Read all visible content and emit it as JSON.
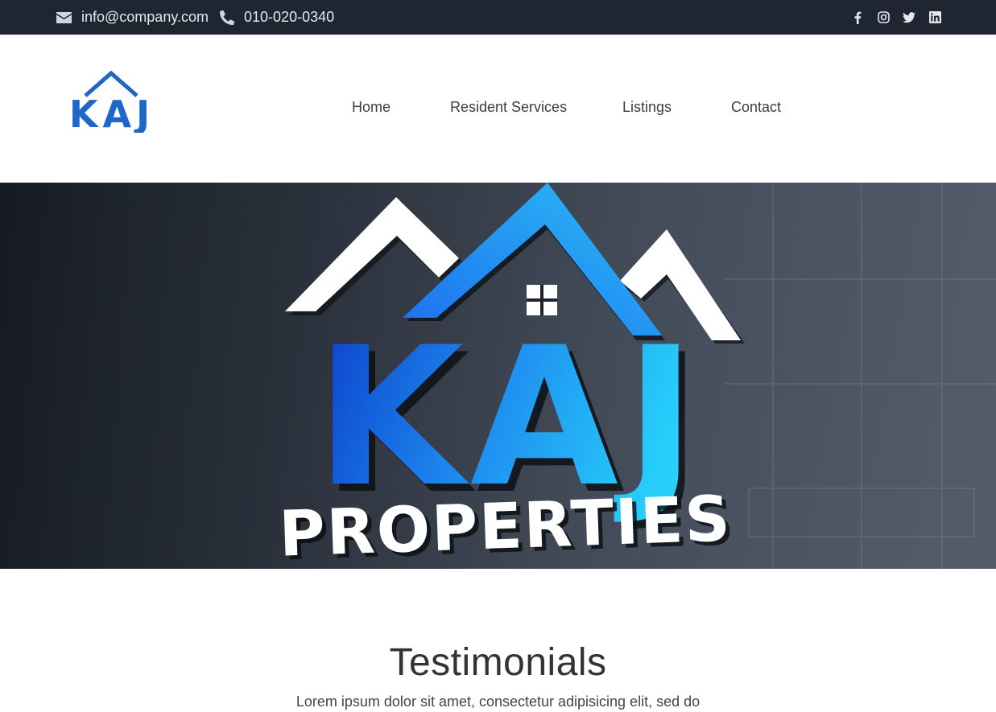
{
  "topbar": {
    "email": "info@company.com",
    "phone": "010-020-0340",
    "social_icons": [
      "facebook-icon",
      "instagram-icon",
      "twitter-icon",
      "linkedin-icon"
    ]
  },
  "header": {
    "logo_text": "KAJ",
    "nav": [
      "Home",
      "Resident Services",
      "Listings",
      "Contact"
    ]
  },
  "hero": {
    "logo_letters": "KAJ",
    "logo_word": "PROPERTIES"
  },
  "testimonials": {
    "title": "Testimonials",
    "text": "Lorem ipsum dolor sit amet, consectetur adipisicing elit, sed do"
  },
  "colors": {
    "topbar_bg": "#1f2631",
    "brand_blue": "#1e66c8",
    "hero_blue_light": "#27c8f5",
    "hero_blue_dark": "#0c3fc9"
  }
}
